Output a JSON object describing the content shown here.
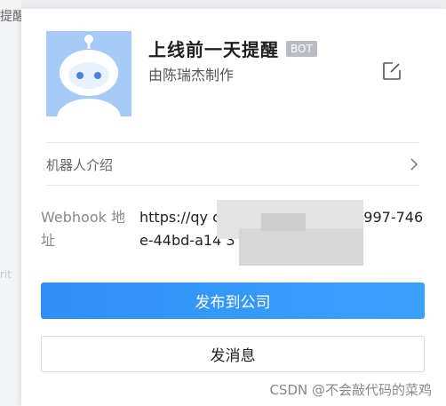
{
  "background": {
    "left_text": "提醒",
    "faint_text": "rit"
  },
  "bot": {
    "name": "上线前一天提醒",
    "badge": "BOT",
    "creator": "由陈瑞杰制作",
    "avatar_icon": "robot-avatar-icon"
  },
  "intro": {
    "label": "机器人介绍",
    "icon": "chevron-right-icon"
  },
  "webhook": {
    "label": "Webhook 地址",
    "value": "https://qy              cgi-bin/webhook/se                9997-746e-44bd-a14                   3"
  },
  "actions": {
    "publish_label": "发布到公司",
    "message_label": "发消息"
  },
  "watermark": "CSDN @不会敲代码的菜鸡",
  "colors": {
    "primary": "#3399ff",
    "avatar_bg": "#a6caf7",
    "badge_bg": "#b9bcc2"
  }
}
